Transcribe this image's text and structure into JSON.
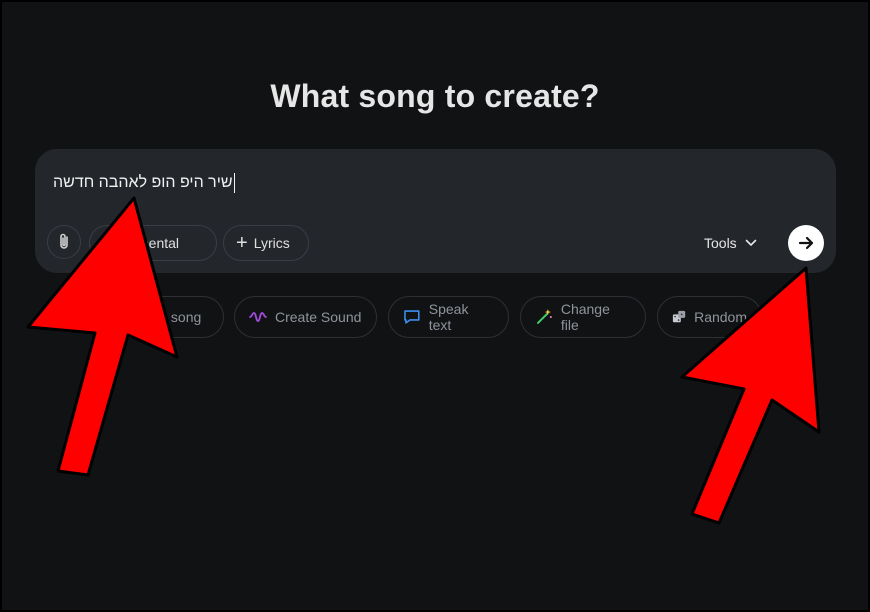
{
  "heading": "What song to create?",
  "composer": {
    "input_value": "שיר היפ הופ לאהבה חדשה",
    "attach_icon": "paperclip-icon",
    "instrumental_label": "Instrumental",
    "lyrics_label": "Lyrics",
    "tools_label": "Tools",
    "send_icon": "arrow-right-icon"
  },
  "suggestions": [
    {
      "label": "Create song",
      "icon": "music-icon"
    },
    {
      "label": "Create Sound",
      "icon": "sound-wave-icon",
      "color": "#a24bdf"
    },
    {
      "label": "Speak text",
      "icon": "speech-bubble-icon",
      "color": "#3b8ff0"
    },
    {
      "label": "Change file",
      "icon": "magic-wand-icon",
      "color": "#3fcf6a"
    },
    {
      "label": "Random",
      "icon": "dice-icon"
    }
  ],
  "colors": {
    "background": "#111214",
    "composer_bg": "#23262b",
    "annotation_arrow": "#ff0000"
  }
}
